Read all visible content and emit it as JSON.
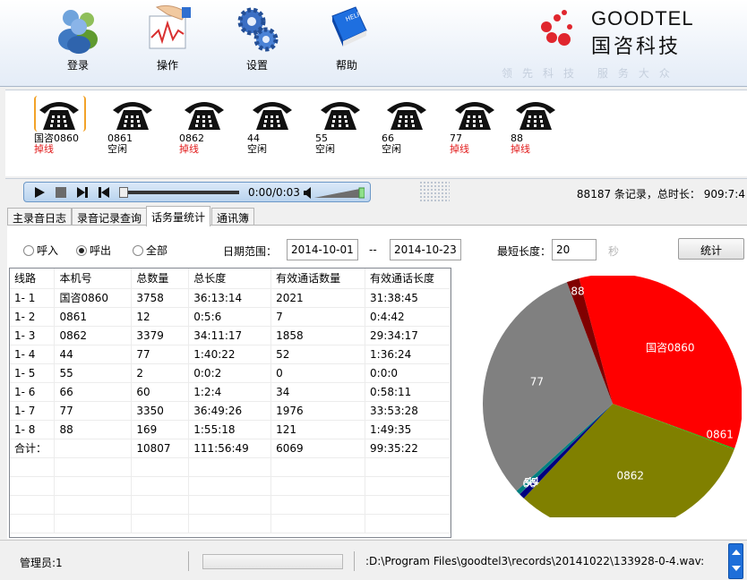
{
  "toolbar": {
    "login": "登录",
    "operate": "操作",
    "settings": "设置",
    "help": "帮助"
  },
  "brand": {
    "name_en": "GOODTEL",
    "name_cn": "国咨科技",
    "slogan": "领先科技 服务大众"
  },
  "phones": [
    {
      "name": "国咨0860",
      "status": "掉线",
      "selected": true
    },
    {
      "name": "0861",
      "status": "空闲",
      "selected": false
    },
    {
      "name": "0862",
      "status": "掉线",
      "selected": false
    },
    {
      "name": "44",
      "status": "空闲",
      "selected": false
    },
    {
      "name": "55",
      "status": "空闲",
      "selected": false
    },
    {
      "name": "66",
      "status": "空闲",
      "selected": false
    },
    {
      "name": "77",
      "status": "掉线",
      "selected": false
    },
    {
      "name": "88",
      "status": "掉线",
      "selected": false
    }
  ],
  "status_colors": {
    "掉线": "#e11b1b",
    "空闲": "#000000"
  },
  "player": {
    "time": "0:00/0:03",
    "volume_level": 1.0
  },
  "summary": "88187 条记录，总时长： 909:7:4",
  "tabs": [
    "主录音日志",
    "录音记录查询",
    "话务量统计",
    "通讯簿"
  ],
  "active_tab": 2,
  "filters": {
    "radios": [
      {
        "label": "呼入",
        "checked": false
      },
      {
        "label": "呼出",
        "checked": true
      },
      {
        "label": "全部",
        "checked": false
      }
    ],
    "date_range_label": "日期范围：",
    "date_from": "2014-10-01",
    "date_sep": "--",
    "date_to": "2014-10-23",
    "min_length_label": "最短长度：",
    "min_length": "20",
    "unit": "秒",
    "stat_button": "统计"
  },
  "table": {
    "columns": [
      "线路",
      "本机号",
      "总数量",
      "总长度",
      "有效通话数量",
      "有效通话长度"
    ],
    "rows": [
      [
        "1- 1",
        "国咨0860",
        "3758",
        "36:13:14",
        "2021",
        "31:38:45"
      ],
      [
        "1- 2",
        "0861",
        "12",
        "0:5:6",
        "7",
        "0:4:42"
      ],
      [
        "1- 3",
        "0862",
        "3379",
        "34:11:17",
        "1858",
        "29:34:17"
      ],
      [
        "1- 4",
        "44",
        "77",
        "1:40:22",
        "52",
        "1:36:24"
      ],
      [
        "1- 5",
        "55",
        "2",
        "0:0:2",
        "0",
        "0:0:0"
      ],
      [
        "1- 6",
        "66",
        "60",
        "1:2:4",
        "34",
        "0:58:11"
      ],
      [
        "1- 7",
        "77",
        "3350",
        "36:49:26",
        "1976",
        "33:53:28"
      ],
      [
        "1- 8",
        "88",
        "169",
        "1:55:18",
        "121",
        "1:49:35"
      ],
      [
        "合计：",
        "",
        "10807",
        "111:56:49",
        "6069",
        "99:35:22"
      ]
    ]
  },
  "chart_data": {
    "type": "pie",
    "slices": [
      {
        "label": "国咨0860",
        "value": 3758,
        "color": "#ff0000"
      },
      {
        "label": "0861",
        "value": 12,
        "color": "#00c000"
      },
      {
        "label": "0862",
        "value": 3379,
        "color": "#808000"
      },
      {
        "label": "44",
        "value": 77,
        "color": "#000080"
      },
      {
        "label": "55",
        "value": 2,
        "color": "#800080"
      },
      {
        "label": "66",
        "value": 60,
        "color": "#008080"
      },
      {
        "label": "77",
        "value": 3350,
        "color": "#808080"
      },
      {
        "label": "88",
        "value": 169,
        "color": "#800000"
      }
    ]
  },
  "statusbar": {
    "admin": "管理员:1",
    "filepath": ":D:\\Program Files\\goodtel3\\records\\20141022\\133928-0-4.wav:"
  }
}
